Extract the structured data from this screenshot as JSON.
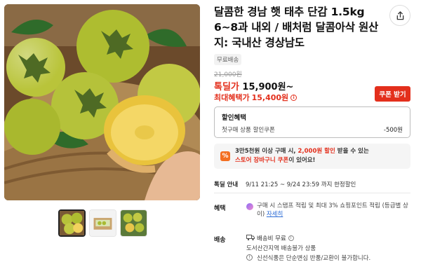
{
  "product": {
    "title": "달콤한 경남 햇 태추 단감 1.5kg 6~8과 내외 / 배처럼 달콤아삭 원산지: 국내산 경상남도",
    "free_shipping_badge": "무료배송",
    "original_price": "21,000원",
    "sale_label": "톡딜가",
    "sale_price": "15,900원~",
    "max_benefit_label": "최대혜택가",
    "max_benefit_price": "15,400원",
    "coupon_button": "쿠폰 받기"
  },
  "discount": {
    "title": "할인혜택",
    "coupon_name": "첫구매 상품 할인쿠폰",
    "amount": "-500원"
  },
  "promo": {
    "icon_text": "%",
    "line1_a": "3만5천원 이상 구매 시,",
    "line1_highlight": "2,000원 할인",
    "line1_b": "받을 수 있는",
    "line2_highlight": "스토어 장바구니 쿠폰",
    "line2_b": "이 있어요!"
  },
  "deal": {
    "label": "톡딜 안내",
    "period": "9/11 21:25 ~ 9/24 23:59 까지 한정할인"
  },
  "benefit": {
    "label": "혜택",
    "text": "구매 시 스탬프 적립 및 최대 3% 쇼핑포인트 적립 (등급별 상이)",
    "link": "자세히"
  },
  "shipping": {
    "label": "배송",
    "fee": "배송비 무료",
    "area": "도서산간지역 배송불가 상품",
    "notice": "신선식품은 단순변심 반품/교환이 불가합니다."
  },
  "icons": {
    "share": "share-icon",
    "info": "info-icon",
    "truck": "truck-icon",
    "notice": "notice-icon",
    "benefit": "point-icon"
  },
  "colors": {
    "accent_red": "#e32f1c",
    "promo_orange": "#f36f21",
    "link_blue": "#2b6bd6"
  }
}
